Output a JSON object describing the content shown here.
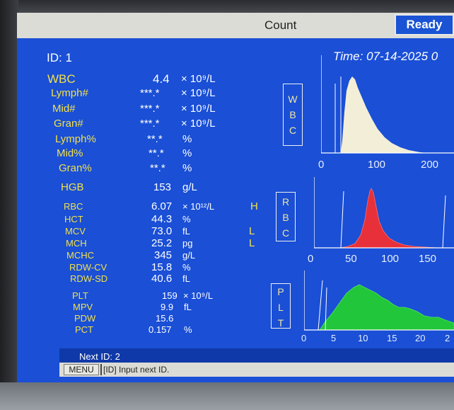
{
  "window": {
    "title": "Count",
    "status": "Ready"
  },
  "header": {
    "id_label": "ID: 1",
    "time_label": "Time: 07-14-2025 0"
  },
  "wbc_params": [
    {
      "name": "WBC",
      "value": "4.4",
      "unit": "× 10⁹/L"
    },
    {
      "name": "Lymph#",
      "value": "***.*",
      "unit": "× 10⁹/L"
    },
    {
      "name": "Mid#",
      "value": "***.*",
      "unit": "× 10⁹/L"
    },
    {
      "name": "Gran#",
      "value": "***.*",
      "unit": "× 10⁹/L"
    },
    {
      "name": "Lymph%",
      "value": "**.*",
      "unit": "%"
    },
    {
      "name": "Mid%",
      "value": "**.*",
      "unit": "%"
    },
    {
      "name": "Gran%",
      "value": "**.*",
      "unit": "%"
    }
  ],
  "hgb": {
    "name": "HGB",
    "value": "153",
    "unit": "g/L"
  },
  "rbc_params": [
    {
      "name": "RBC",
      "value": "6.07",
      "unit": "× 10¹²/L",
      "flag": "H"
    },
    {
      "name": "HCT",
      "value": "44.3",
      "unit": "%",
      "flag": ""
    },
    {
      "name": "MCV",
      "value": "73.0",
      "unit": "fL",
      "flag": "L"
    },
    {
      "name": "MCH",
      "value": "25.2",
      "unit": "pg",
      "flag": "L"
    },
    {
      "name": "MCHC",
      "value": "345",
      "unit": "g/L",
      "flag": ""
    },
    {
      "name": "RDW-CV",
      "value": "15.8",
      "unit": "%",
      "flag": ""
    },
    {
      "name": "RDW-SD",
      "value": "40.6",
      "unit": "fL",
      "flag": ""
    }
  ],
  "plt_params": [
    {
      "name": "PLT",
      "value": "159",
      "unit": "× 10⁹/L"
    },
    {
      "name": "MPV",
      "value": "9.9",
      "unit": "fL"
    },
    {
      "name": "PDW",
      "value": "15.6",
      "unit": ""
    },
    {
      "name": "PCT",
      "value": "0.157",
      "unit": "%"
    }
  ],
  "histograms": {
    "wbc": {
      "label": [
        "W",
        "B",
        "C"
      ],
      "ticks": [
        "0",
        "100",
        "200"
      ],
      "color": "#f3eed8"
    },
    "rbc": {
      "label": [
        "R",
        "B",
        "C"
      ],
      "ticks": [
        "0",
        "50",
        "100",
        "150"
      ],
      "color": "#e8303a"
    },
    "plt": {
      "label": [
        "P",
        "L",
        "T"
      ],
      "ticks": [
        "0",
        "5",
        "10",
        "15",
        "20",
        "2"
      ],
      "color": "#22c63a"
    }
  },
  "footer": {
    "next_id": "Next ID: 2",
    "menu_label": "MENU",
    "status_message": "[ID] Input next ID."
  }
}
